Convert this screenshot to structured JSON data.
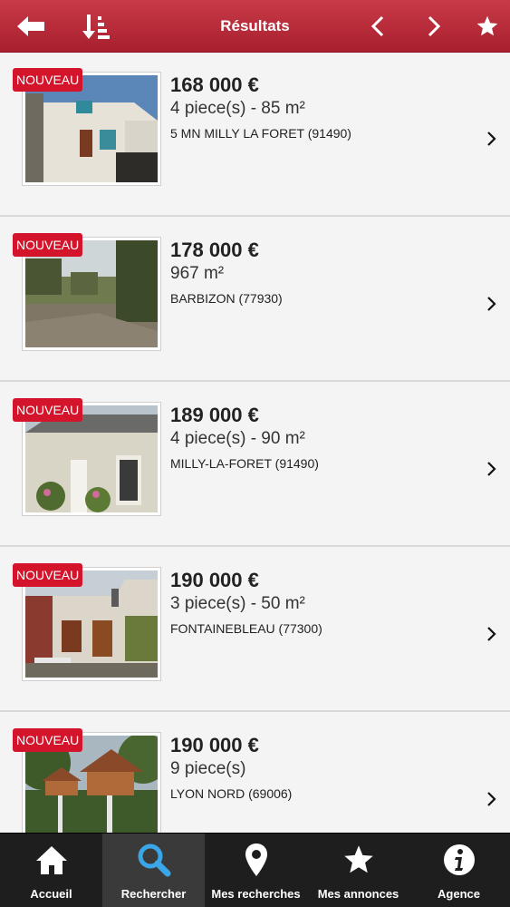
{
  "header": {
    "title": "Résultats",
    "back_icon": "back-arrow-icon",
    "sort_icon": "sort-icon",
    "prev_icon": "chevron-left-icon",
    "next_icon": "chevron-right-icon",
    "favorite_icon": "star-icon"
  },
  "results": [
    {
      "badge": "NOUVEAU",
      "price": "168 000 €",
      "surface": "4 piece(s) - 85 m²",
      "location": "5 MN MILLY LA FORET (91490)"
    },
    {
      "badge": "NOUVEAU",
      "price": "178 000 €",
      "surface": "967 m²",
      "location": "BARBIZON (77930)"
    },
    {
      "badge": "NOUVEAU",
      "price": "189 000 €",
      "surface": "4 piece(s) - 90 m²",
      "location": "MILLY-LA-FORET (91490)"
    },
    {
      "badge": "NOUVEAU",
      "price": "190 000 €",
      "surface": "3 piece(s) - 50 m²",
      "location": "FONTAINEBLEAU (77300)"
    },
    {
      "badge": "NOUVEAU",
      "price": "190 000 €",
      "surface": "9 piece(s)",
      "location": "LYON NORD (69006)"
    }
  ],
  "tabbar": {
    "active": "Rechercher",
    "tabs": [
      {
        "label": "Accueil",
        "icon": "home-icon"
      },
      {
        "label": "Rechercher",
        "icon": "search-icon"
      },
      {
        "label": "Mes recherches",
        "icon": "map-pin-icon"
      },
      {
        "label": "Mes annonces",
        "icon": "star-icon"
      },
      {
        "label": "Agence",
        "icon": "info-icon"
      }
    ]
  },
  "colors": {
    "header": "#b22a38",
    "badge": "#d3142b",
    "tabbar": "#1e1e1e"
  }
}
